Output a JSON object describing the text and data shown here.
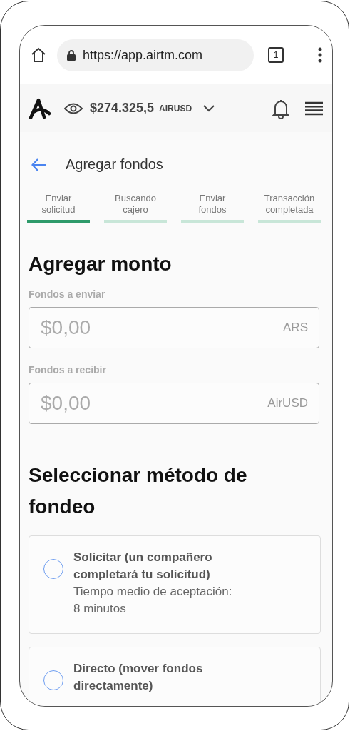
{
  "browser": {
    "url": "https://app.airtm.com",
    "tab_count": "1"
  },
  "header": {
    "balance": "$274.325,5",
    "currency": "AIRUSD"
  },
  "page": {
    "title": "Agregar fondos"
  },
  "steps": [
    {
      "label": "Enviar solicitud",
      "selected": true
    },
    {
      "label": "Buscando cajero",
      "selected": false
    },
    {
      "label": "Enviar fondos",
      "selected": false
    },
    {
      "label": "Transacción completada",
      "selected": false
    }
  ],
  "amount": {
    "title": "Agregar monto",
    "fields": [
      {
        "label": "Fondos a enviar",
        "placeholder": "$0,00",
        "currency": "ARS"
      },
      {
        "label": "Fondos a recibir",
        "placeholder": "$0,00",
        "currency": "AirUSD"
      }
    ]
  },
  "methods": {
    "title": "Seleccionar método de fondeo",
    "options": [
      {
        "title": "Solicitar (un compañero completará tu solicitud)",
        "detail": "Tiempo medio de aceptación: 8 minutos",
        "selected": false
      },
      {
        "title": "Directo (mover fondos directamente)",
        "selected": false
      }
    ]
  }
}
